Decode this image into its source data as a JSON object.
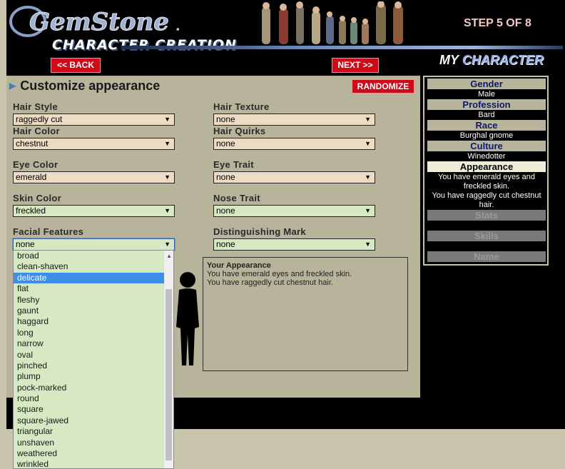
{
  "header": {
    "logo": "GemStone IV",
    "subtitle": "CHARACTER CREATION",
    "step": "STEP 5 OF 8",
    "back_label": "<< BACK",
    "next_label": "NEXT >>",
    "my": "MY",
    "character": "CHARACTER"
  },
  "panel": {
    "title": "Customize appearance",
    "randomize_label": "RANDOMIZE",
    "fields": {
      "hair_style": {
        "label": "Hair Style",
        "value": "raggedly cut"
      },
      "hair_texture": {
        "label": "Hair Texture",
        "value": "none"
      },
      "hair_color": {
        "label": "Hair Color",
        "value": "chestnut"
      },
      "hair_quirks": {
        "label": "Hair Quirks",
        "value": "none"
      },
      "eye_color": {
        "label": "Eye Color",
        "value": "emerald"
      },
      "eye_trait": {
        "label": "Eye Trait",
        "value": "none"
      },
      "skin_color": {
        "label": "Skin Color",
        "value": "freckled"
      },
      "nose_trait": {
        "label": "Nose Trait",
        "value": "none"
      },
      "facial_features": {
        "label": "Facial Features",
        "value": "none"
      },
      "distinguishing_mark": {
        "label": "Distinguishing Mark",
        "value": "none"
      }
    },
    "appearance_box": {
      "title": "Your Appearance",
      "line1": "You have emerald eyes and freckled skin.",
      "line2": "You have raggedly cut chestnut hair."
    }
  },
  "dropdown": {
    "selected": "delicate",
    "options": [
      "broad",
      "clean-shaven",
      "delicate",
      "flat",
      "fleshy",
      "gaunt",
      "haggard",
      "long",
      "narrow",
      "oval",
      "pinched",
      "plump",
      "pock-marked",
      "round",
      "square",
      "square-jawed",
      "triangular",
      "unshaven",
      "weathered",
      "wrinkled"
    ]
  },
  "sidebar": {
    "gender": {
      "label": "Gender",
      "value": "Male"
    },
    "profession": {
      "label": "Profession",
      "value": "Bard"
    },
    "race": {
      "label": "Race",
      "value": "Burghal gnome"
    },
    "culture": {
      "label": "Culture",
      "value": "Winedotter"
    },
    "appearance": {
      "label": "Appearance",
      "value1": "You have emerald eyes and freckled skin.",
      "value2": "You have raggedly cut chestnut hair."
    },
    "stats": {
      "label": "Stats"
    },
    "skills": {
      "label": "Skills"
    },
    "name": {
      "label": "Name"
    }
  }
}
